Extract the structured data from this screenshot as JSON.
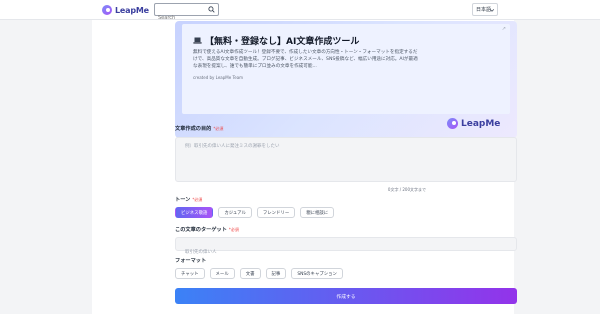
{
  "header": {
    "logo_text": "LeapMe",
    "search_placeholder": "Search",
    "language": "日本語"
  },
  "hero": {
    "title": "【無料・登録なし】AI文章作成ツール",
    "description": "無料で使えるAI文章作成ツール！登録不要で、作成したい文章の方向性・トーン・フォーマットを指定するだけで、高品質な文章を自動生成。ブログ記事、ビジネスメール、SNS投稿など、幅広い用途に対応。AIが最適な表現を提案し、誰でも簡単にプロ並みの文章を作成可能...",
    "credit": "created by LeapMe Team",
    "brand": "LeapMe"
  },
  "purpose": {
    "label": "文章作成の目的",
    "required": "*必須",
    "placeholder": "例）取引先の偉い人に発注ミスの謝罪をしたい",
    "counter": "0文字 / 200文字まで"
  },
  "tone": {
    "label": "トーン",
    "required": "*必須",
    "options": [
      "ビジネス敬語",
      "カジュアル",
      "フレンドリー",
      "親に相談に"
    ],
    "selected_index": 0
  },
  "target": {
    "label": "この文章のターゲット",
    "required": "*必須",
    "placeholder": "取引先の偉い人"
  },
  "format": {
    "label": "フォーマット",
    "options": [
      "チャット",
      "メール",
      "文書",
      "記事",
      "SNSのキャプション"
    ]
  },
  "submit_label": "作成する",
  "colors": {
    "accent_start": "#3b82f6",
    "accent_end": "#9333ea",
    "required": "#ef4444"
  }
}
